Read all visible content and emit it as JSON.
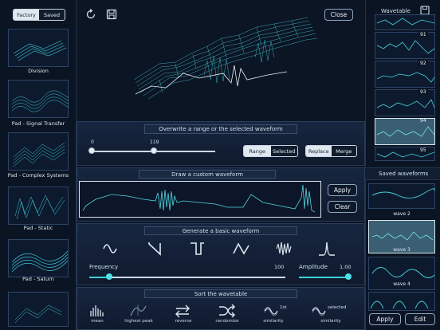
{
  "top_tabs": {
    "factory": "Factory",
    "saved": "Saved"
  },
  "toolbar": {
    "close": "Close"
  },
  "presets": [
    {
      "label": "Division"
    },
    {
      "label": "Pad - Signal Transfer"
    },
    {
      "label": "Pad - Complex Systems"
    },
    {
      "label": "Pad - Static"
    },
    {
      "label": "Pad - Saturn"
    }
  ],
  "overwrite": {
    "title": "Overwrite a range or the selected waveform",
    "range_start": "0",
    "range_end": "119",
    "range_btn": "Range",
    "selected_btn": "Selected",
    "replace_btn": "Replace",
    "merge_btn": "Merge"
  },
  "draw": {
    "title": "Draw a custom waveform",
    "apply": "Apply",
    "clear": "Clear"
  },
  "generate": {
    "title": "Generate a basic waveform",
    "frequency_label": "Frequency",
    "frequency_value": "100",
    "amplitude_label": "Amplitude",
    "amplitude_value": "1.00",
    "frequency_fraction": 0.1,
    "amplitude_fraction": 1.0,
    "shapes": [
      "sine-icon",
      "sawtooth-icon",
      "square-icon",
      "triangle-icon",
      "noise-icon",
      "pulse-icon"
    ]
  },
  "sort": {
    "title": "Sort the wavetable",
    "items": [
      {
        "label": "mean",
        "icon": "mean-icon"
      },
      {
        "label": "highest peak",
        "icon": "highest-peak-icon"
      },
      {
        "label": "reverse",
        "icon": "reverse-icon"
      },
      {
        "label": "randomize",
        "icon": "randomize-icon"
      },
      {
        "label": "similarity",
        "icon": "similarity-1st-icon",
        "badge": "1st"
      },
      {
        "label": "similarity",
        "icon": "similarity-selected-icon",
        "badge": "selected"
      }
    ]
  },
  "wavetable": {
    "title": "Wavetable",
    "frames": [
      "91",
      "92",
      "93",
      "94",
      "95"
    ],
    "selected_frame": "94"
  },
  "saved_waveforms": {
    "title": "Saved waveforms",
    "items": [
      "wave 2",
      "wave 3",
      "wave 4"
    ],
    "selected": "wave 3",
    "apply": "Apply",
    "edit": "Edit"
  },
  "colors": {
    "accent": "#39d1db",
    "bg": "#0c1524",
    "panel": "#172640"
  }
}
